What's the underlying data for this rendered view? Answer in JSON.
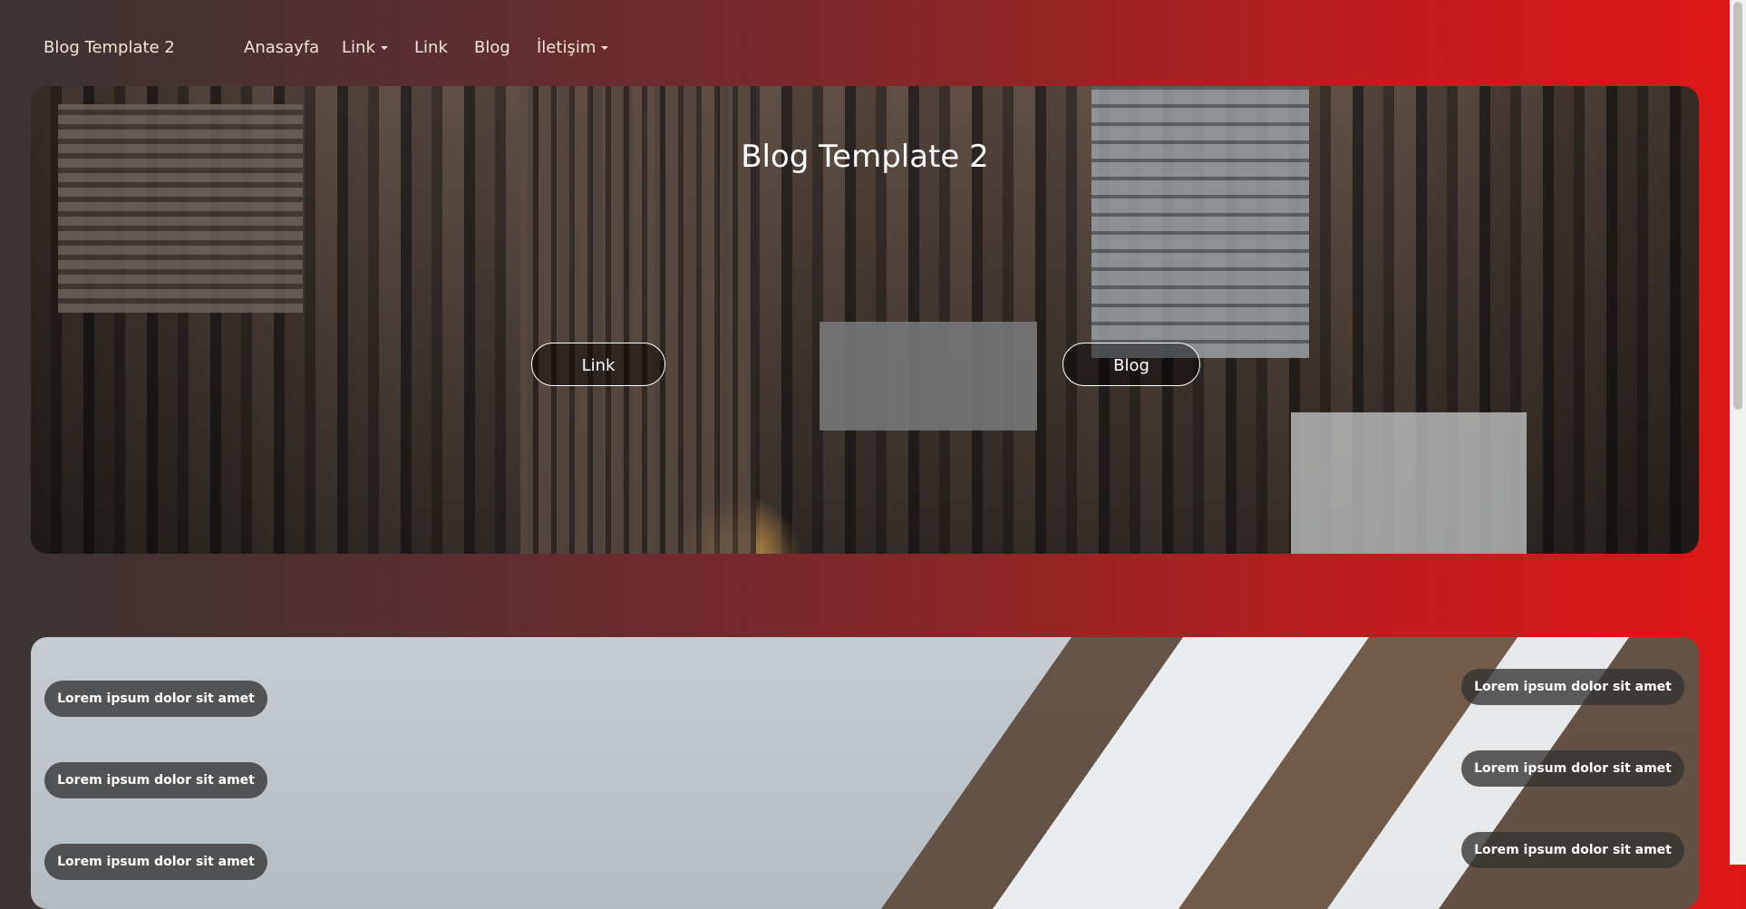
{
  "navbar": {
    "brand": "Blog Template 2",
    "items": [
      {
        "label": "Anasayfa"
      },
      {
        "label": "Link"
      },
      {
        "label": "Link"
      },
      {
        "label": "Blog"
      },
      {
        "label": "İletişim"
      }
    ]
  },
  "hero": {
    "title": "Blog Template 2",
    "buttons": [
      {
        "label": "Link"
      },
      {
        "label": "Blog"
      }
    ]
  },
  "section2": {
    "left_pills": [
      "Lorem ipsum dolor sit amet",
      "Lorem ipsum dolor sit amet",
      "Lorem ipsum dolor sit amet"
    ],
    "right_pills": [
      "Lorem ipsum dolor sit amet",
      "Lorem ipsum dolor sit amet",
      "Lorem ipsum dolor sit amet"
    ]
  },
  "colors": {
    "gradient_left": "#3b3434",
    "gradient_right": "#e01616",
    "nav_text": "#f3e6d8"
  }
}
